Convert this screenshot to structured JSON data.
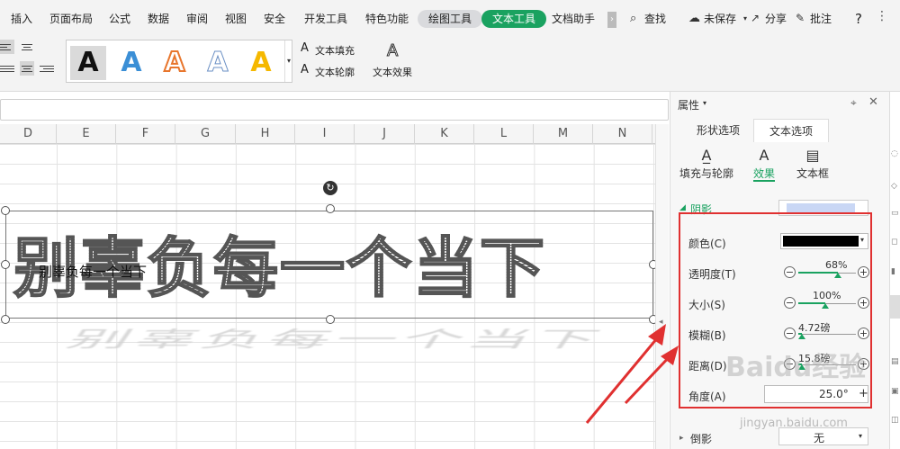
{
  "ribbon_tabs": [
    "插入",
    "页面布局",
    "公式",
    "数据",
    "审阅",
    "视图",
    "安全",
    "开发工具",
    "特色功能",
    "绘图工具",
    "文本工具",
    "文档助手"
  ],
  "toolbar_right": {
    "find": "查找",
    "unsaved": "未保存",
    "share": "分享",
    "comment": "批注",
    "help": "?"
  },
  "wordart_letters": [
    "A",
    "A",
    "A",
    "A",
    "A"
  ],
  "text_fill_label": "文本填充",
  "text_outline_label": "文本轮廓",
  "text_effect_label": "文本效果",
  "columns": [
    "D",
    "E",
    "F",
    "G",
    "H",
    "I",
    "J",
    "K",
    "L",
    "M",
    "N"
  ],
  "wordart_text": "别辜负每一个当下",
  "wordart_small": "别辜负每一个当下",
  "panel": {
    "title": "属性",
    "tab_shape": "形状选项",
    "tab_text": "文本选项",
    "sub_fill": "填充与轮廓",
    "sub_effect": "效果",
    "sub_textbox": "文本框",
    "shadow_header": "阴影",
    "color_label": "颜色(C)",
    "transparency_label": "透明度(T)",
    "transparency_value": "68%",
    "size_label": "大小(S)",
    "size_value": "100%",
    "blur_label": "模糊(B)",
    "blur_value": "4.72磅",
    "distance_label": "距离(D)",
    "distance_value": "15.8磅",
    "angle_label": "角度(A)",
    "angle_value": "25.0°",
    "reflection_label": "倒影",
    "reflection_value": "无"
  },
  "watermark": "Baidu经验",
  "watermark_url": "jingyan.baidu.com",
  "colors": {
    "accent": "#1aa260",
    "annotation": "#e03030"
  }
}
